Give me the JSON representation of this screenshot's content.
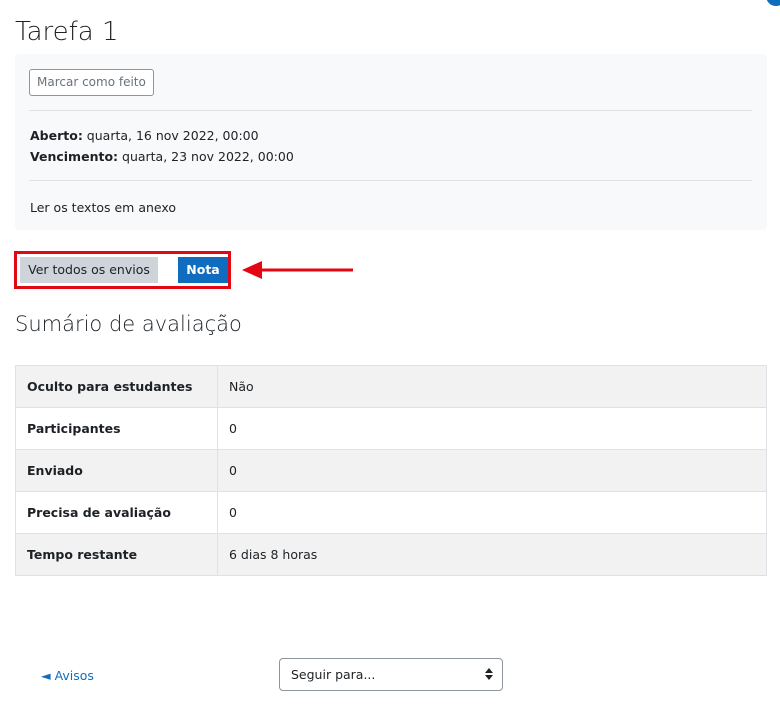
{
  "page": {
    "title": "Tarefa 1"
  },
  "activity": {
    "mark_done_label": "Marcar como feito",
    "opened_label": "Aberto:",
    "opened_value": " quarta, 16 nov 2022, 00:00",
    "due_label": "Vencimento:",
    "due_value": " quarta, 23 nov 2022, 00:00",
    "description": "Ler os textos em anexo"
  },
  "actions": {
    "view_submissions": "Ver todos os envios",
    "grade": "Nota"
  },
  "summary": {
    "title": "Sumário de avaliação",
    "rows": [
      {
        "label": "Oculto para estudantes",
        "value": "Não"
      },
      {
        "label": "Participantes",
        "value": "0"
      },
      {
        "label": "Enviado",
        "value": "0"
      },
      {
        "label": "Precisa de avaliação",
        "value": "0"
      },
      {
        "label": "Tempo restante",
        "value": "6 dias 8 horas"
      }
    ]
  },
  "footer": {
    "prev_link": "◄ Avisos",
    "jump_placeholder": "Seguir para..."
  },
  "colors": {
    "accent": "#0f6cbf",
    "highlight": "#e30613"
  }
}
